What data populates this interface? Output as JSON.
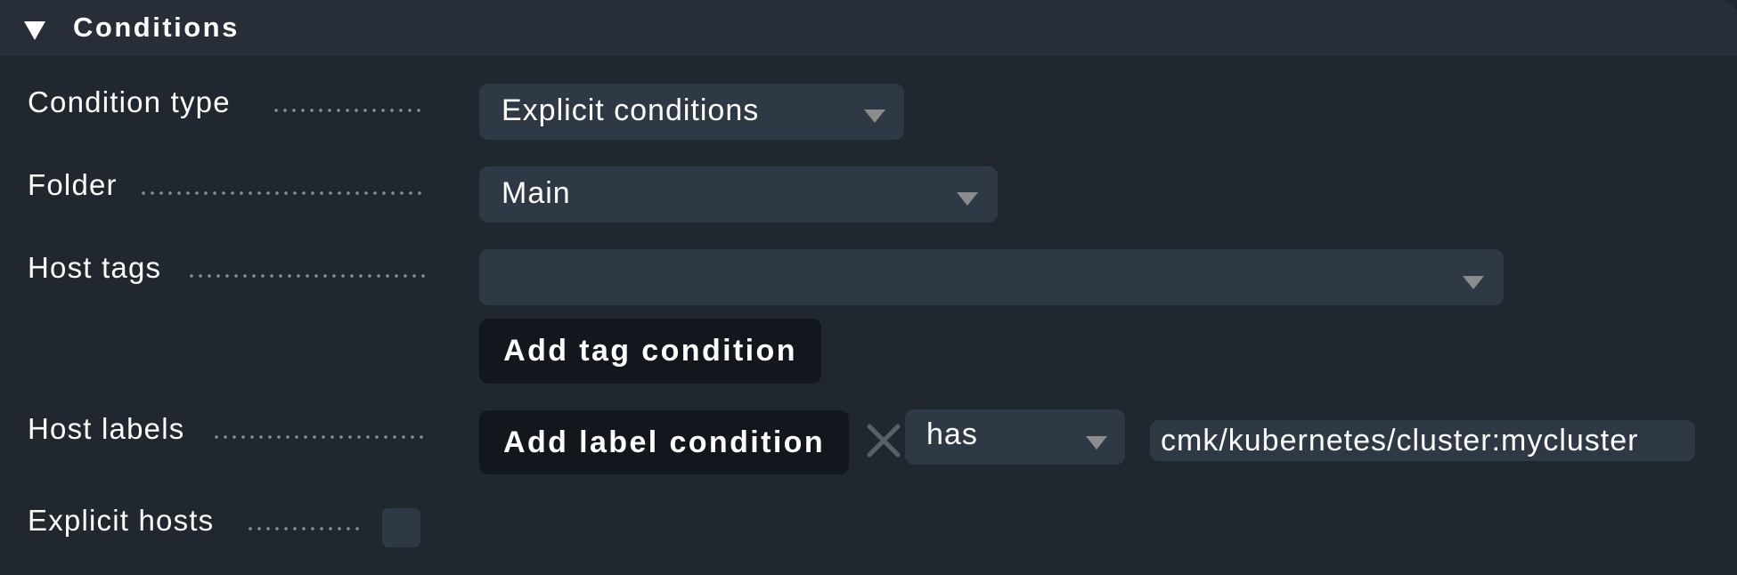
{
  "section": {
    "title": "Conditions",
    "collapse_icon": "triangle-down-icon",
    "expanded": true
  },
  "rows": {
    "condition_type": {
      "label": "Condition type",
      "selected": "Explicit conditions"
    },
    "folder": {
      "label": "Folder",
      "selected": "Main"
    },
    "host_tags": {
      "label": "Host tags",
      "selected": "",
      "add_button": "Add tag condition"
    },
    "host_labels": {
      "label": "Host labels",
      "add_button": "Add label condition",
      "remove_icon": "x-icon",
      "operator": "has",
      "value": "cmk/kubernetes/cluster:mycluster"
    },
    "explicit_hosts": {
      "label": "Explicit hosts",
      "checked": false
    }
  },
  "colors": {
    "background": "#21272f",
    "header_background": "#272e38",
    "field_background": "#2f3946",
    "button_background": "#12171d",
    "dropdown_arrow": "#8c8c8c",
    "leader_dots": "#8a8f96",
    "remove_icon": "#5a6068"
  }
}
